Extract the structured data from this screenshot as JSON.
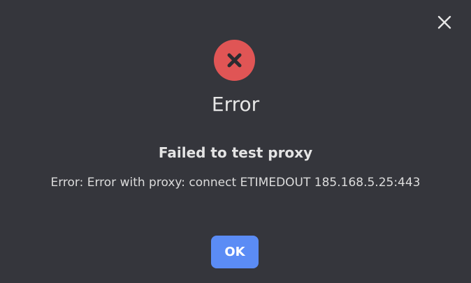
{
  "dialog": {
    "title": "Error",
    "heading": "Failed to test proxy",
    "message": "Error: Error with proxy: connect ETIMEDOUT 185.168.5.25:443",
    "ok_label": "OK",
    "icons": {
      "close": "close-icon",
      "status": "error-x-icon"
    },
    "colors": {
      "background": "#35363c",
      "error": "#e05555",
      "primary_button": "#5b8cf5"
    }
  }
}
